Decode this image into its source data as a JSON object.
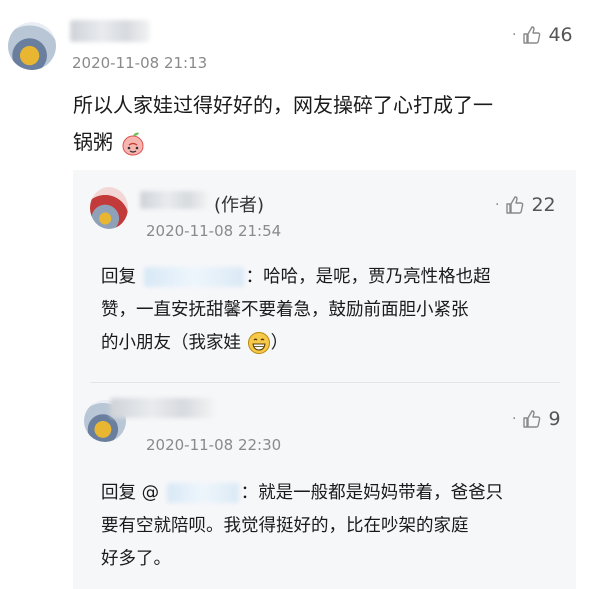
{
  "main_comment": {
    "timestamp": "2020-11-08 21:13",
    "likes": "46",
    "text_line1": "所以人家娃过得好好的，网友操碎了心打成了一",
    "text_line2": "锅粥",
    "emoji_icon": "peach-emoji"
  },
  "replies": [
    {
      "author_tag": "(作者)",
      "timestamp": "2020-11-08 21:54",
      "likes": "22",
      "reply_prefix": "回复",
      "text_line1": "：哈哈，是呢，贾乃亮性格也超",
      "text_line2": "赞，一直安抚甜馨不要着急，鼓励前面胆小紧张",
      "text_line3": "的小朋友（我家娃",
      "text_after_emoji": "）",
      "emoji_icon": "grin-emoji"
    },
    {
      "timestamp": "2020-11-08 22:30",
      "likes": "9",
      "reply_prefix": "回复 @",
      "text_line1": "：就是一般都是妈妈带着，爸爸只",
      "text_line2": "要有空就陪呗。我觉得挺好的，比在吵架的家庭",
      "text_line3": "好多了。"
    }
  ]
}
